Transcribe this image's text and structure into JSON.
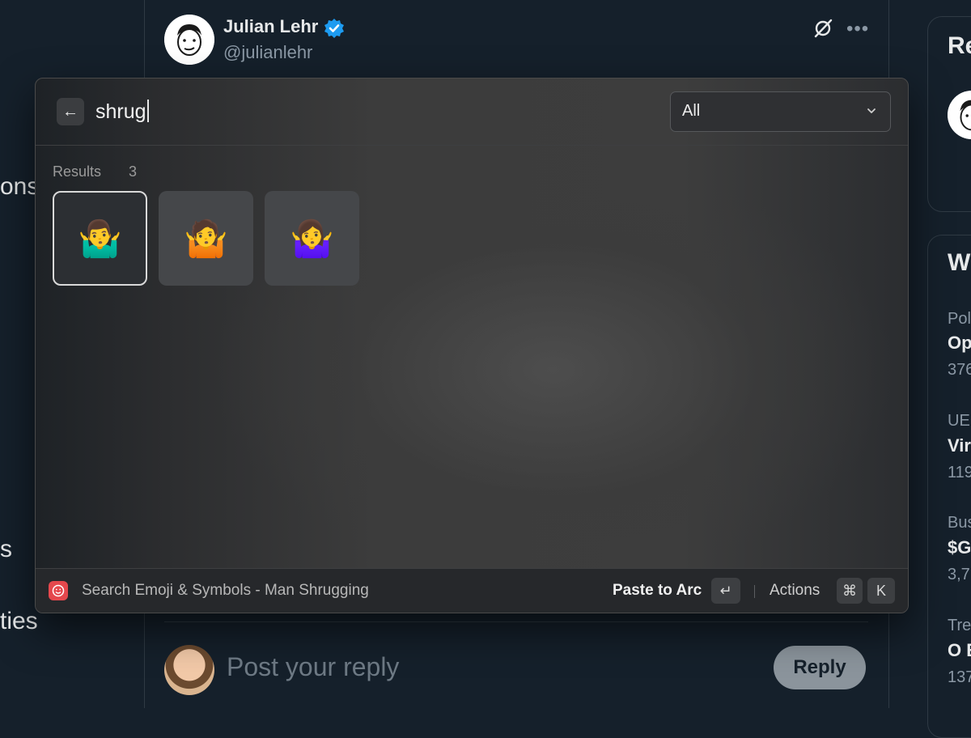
{
  "left_nav": {
    "item1": "ons",
    "item2": "s",
    "item3": "ties"
  },
  "tweet": {
    "name": "Julian Lehr",
    "handle": "@julianlehr",
    "more": "•••"
  },
  "reply": {
    "placeholder": "Post your reply",
    "button": "Reply"
  },
  "right_sidebar": {
    "card1_title": "Re",
    "card2_title": "W",
    "trends": [
      {
        "category": "Pol",
        "title": "Op",
        "count": "376"
      },
      {
        "category": "UE",
        "title": "Vir",
        "count": "119"
      },
      {
        "category": "Bus",
        "title": "$G",
        "count": "3,7!"
      },
      {
        "category": "Tre",
        "title": "O E",
        "count": "137"
      }
    ]
  },
  "raycast": {
    "back_icon": "←",
    "search_query": "shrug",
    "filter": {
      "selected": "All"
    },
    "results_label": "Results",
    "results_count": "3",
    "emojis": [
      "🤷‍♂️",
      "🤷",
      "🤷‍♀️"
    ],
    "footer": {
      "title": "Search Emoji & Symbols - Man Shrugging",
      "primary_action": "Paste to Arc",
      "enter_key": "↵",
      "actions_label": "Actions",
      "cmd_key": "⌘",
      "k_key": "K"
    }
  },
  "colors": {
    "background": "#15202b",
    "panel_bg": "#3d3d3d",
    "accent_red": "#e5484d",
    "verified_blue": "#1d9bf0"
  }
}
